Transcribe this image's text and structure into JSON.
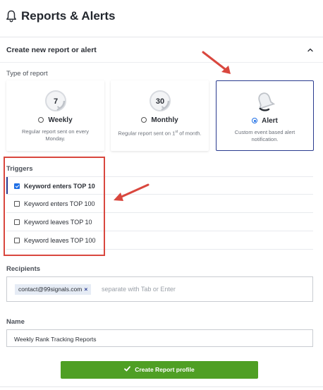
{
  "header": {
    "title": "Reports & Alerts",
    "icon": "bell-icon"
  },
  "section": {
    "label": "Create new report or alert",
    "icon": "chevron-up-icon"
  },
  "type_of_report": {
    "label": "Type of report",
    "options": [
      {
        "badge": "7",
        "name": "Weekly",
        "desc": "Regular report sent on every Monday.",
        "selected": false
      },
      {
        "badge": "30",
        "name": "Monthly",
        "desc_pre": "Regular report sent on 1",
        "desc_sup": "st",
        "desc_post": " of month.",
        "selected": false
      },
      {
        "badge": "",
        "name": "Alert",
        "desc": "Custom event based alert notification.",
        "selected": true
      }
    ]
  },
  "triggers": {
    "label": "Triggers",
    "items": [
      {
        "label": "Keyword enters TOP 10",
        "checked": true
      },
      {
        "label": "Keyword enters TOP 100",
        "checked": false
      },
      {
        "label": "Keyword leaves TOP 10",
        "checked": false
      },
      {
        "label": "Keyword leaves TOP 100",
        "checked": false
      }
    ]
  },
  "recipients": {
    "label": "Recipients",
    "chip": "contact@99signals.com",
    "chip_remove": "×",
    "placeholder": "separate with Tab or Enter"
  },
  "name_field": {
    "label": "Name",
    "value": "Weekly Rank Tracking Reports"
  },
  "create_button": {
    "label": "Create Report profile",
    "icon": "check-icon"
  },
  "colors": {
    "accent": "#2a3b8f",
    "radio_blue": "#1f6fe5",
    "button_green": "#4f9f24",
    "annotation_red": "#d9473e"
  }
}
